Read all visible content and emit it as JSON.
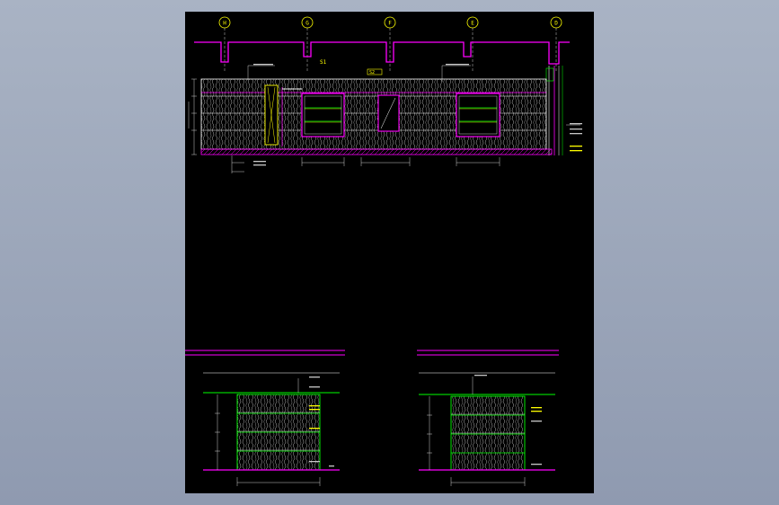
{
  "drawing": {
    "axis_bubbles": [
      "H",
      "G",
      "F",
      "E",
      "D"
    ],
    "colors": {
      "background": "#000000",
      "wall_outline": "#ff00ff",
      "panel_outline": "#00ff00",
      "dimension": "#ffffff",
      "annotation": "#ffff00",
      "hatching": "#c8c8c8",
      "magenta": "#ff00ff",
      "cyan": "#00ffff"
    },
    "main_elevation": {
      "tags": [
        "S1",
        "S2"
      ]
    },
    "detail_left": {},
    "detail_right": {}
  }
}
